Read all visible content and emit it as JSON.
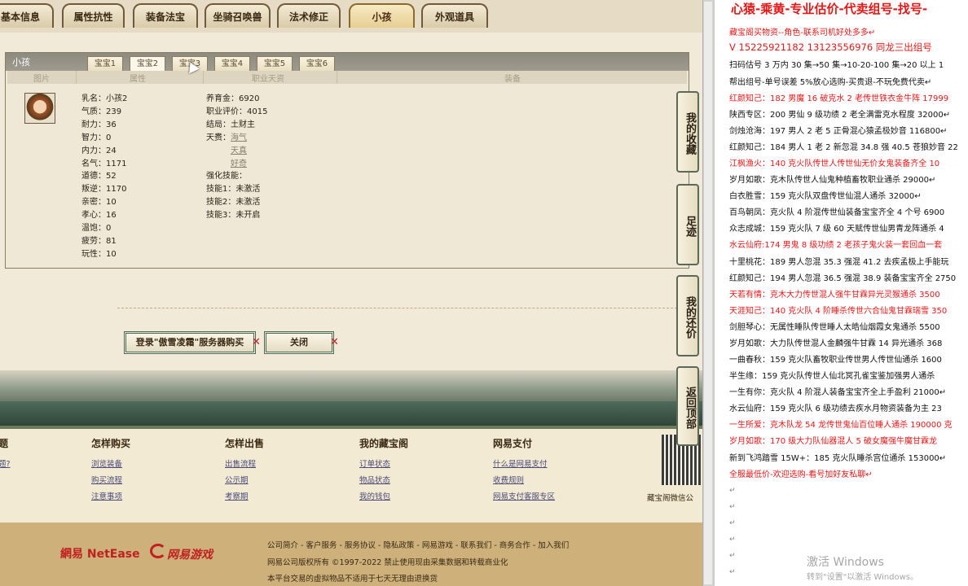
{
  "main_tabs": [
    "基本信息",
    "属性抗性",
    "装备法宝",
    "坐骑召唤兽",
    "法术修正",
    "小孩",
    "外观道具"
  ],
  "active_main_tab": "小孩",
  "panel": {
    "title": "小孩",
    "sub_tabs": [
      "宝宝1",
      "宝宝2",
      "宝宝3",
      "宝宝4",
      "宝宝5",
      "宝宝6"
    ],
    "active_sub_tab": "宝宝2",
    "columns": [
      "图片",
      "属性",
      "职业天资",
      "装备"
    ]
  },
  "child": {
    "stats": [
      "乳名：小孩2",
      "气质：239",
      "耐力：36",
      "智力：0",
      "内力：24",
      "名气：1171",
      "道德：52",
      "叛逆：1170",
      "亲密：10",
      "孝心：16",
      "温饱：0",
      "疲劳：81",
      "玩性：10"
    ],
    "career": {
      "money": "养育金：6920",
      "rating": "职业评价：4015",
      "ending": "结局：土财主",
      "talent_label": "天赉：",
      "talents": [
        "海气",
        "天真",
        "好奇"
      ],
      "enhance": "强化技能：",
      "skills": [
        "技能1：未激活",
        "技能2：未激活",
        "技能3：未开启"
      ]
    }
  },
  "buttons": {
    "register": "登录\"傲雪凌霜\"服务器购买",
    "close": "关闭",
    "x": "✕"
  },
  "side_buttons": [
    "我的收藏",
    "足迹",
    "我的还价",
    "返回顶部"
  ],
  "footer": {
    "columns": [
      {
        "title": "怎样购买",
        "links": [
          "浏览装备",
          "购买流程",
          "注意事项"
        ]
      },
      {
        "title": "怎样出售",
        "links": [
          "出售流程",
          "公示期",
          "考察期"
        ]
      },
      {
        "title": "我的藏宝阁",
        "links": [
          "订单状态",
          "物品状态",
          "我的钱包"
        ]
      },
      {
        "title": "网易支付",
        "links": [
          "什么是网易支付",
          "收费规则",
          "网易支付客服专区"
        ]
      }
    ],
    "partial_col_title": "题",
    "partial_col_link": "题?",
    "qr_caption": "藏宝阁微信公",
    "logos": [
      "網易 NetEase",
      "网易游戏"
    ],
    "bottom_lines": [
      "公司简介 - 客户服务 - 服务协议 - 隐私政策 - 网易游戏 - 联系我们 - 商务合作 - 加入我们",
      "网易公司版权所有 ©1997-2022  禁止使用现由采集数据和转载商业化",
      "本平台交易的虚拟物品不适用于七天无理由退换货"
    ]
  },
  "right_doc": {
    "title": "心猿-乘黄-专业估价-代卖组号-找号-",
    "lines": [
      {
        "text": "藏宝阁买物资--角色-联系司机好处多多↵",
        "red": true
      },
      {
        "text": "V 15225921182   13123556976 同龙三出组号",
        "red": true
      },
      {
        "text": "扫码估号 3 万内 30 集→50 集→10-20-100 集→20 以上 1",
        "red": false
      },
      {
        "text": "帮出组号-单号误差 5%放心选购-买贵退-不玩免费代卖↵",
        "red": false
      },
      {
        "text": "红颜知己：182 男魔 16 破克水 2 老传世铁衣金牛阵 17999",
        "red": true
      },
      {
        "text": "陕西专区：200 男仙 9 级功绩 2 老全满雷克水程度 32000↵",
        "red": false
      },
      {
        "text": "剑烛沧海：197 男人 2 老 5 正骨混心猿孟极妙音 116800↵",
        "red": false
      },
      {
        "text": "红颜知己：184 男人 1 老 2 新忽混 34.8 强 40.5 苍狼妙音 22",
        "red": false
      },
      {
        "text": "江枫渔火：140 克火队传世人传世仙无价女鬼装备齐全 10",
        "red": true
      },
      {
        "text": "岁月如歌：克木队传世人仙鬼种植畜牧职业通杀 29000↵",
        "red": false
      },
      {
        "text": "白衣胜雪：159 克火队双盘传世仙混人通杀 32000↵",
        "red": false
      },
      {
        "text": "百鸟朝凤：克火队 4 阶混传世仙装备宝宝齐全 4 个号 6900",
        "red": false
      },
      {
        "text": "众志成城：159 克火队 7 级 60 天赋传世仙男青龙阵通杀 4",
        "red": false
      },
      {
        "text": "水云仙府:174 男鬼 8 级功绩 2 老孩子鬼火装一套回血一套",
        "red": true
      },
      {
        "text": "十里桃花：189 男人忽混 35.3 强混 41.2 去疾孟极上手能玩",
        "red": false
      },
      {
        "text": "红颜知己：194 男人忽混 36.5 强混 38.9 装备宝宝齐全 2750",
        "red": false
      },
      {
        "text": "天若有情：克木大力传世混人强牛甘霖异光灵猴通杀 3500",
        "red": true
      },
      {
        "text": "天涯知己：140 克火队 4 阶睡杀传世六合仙鬼甘霖瑞雪 350",
        "red": true
      },
      {
        "text": "剑胆琴心：无属性睡队传世睡人太皓仙烟霞女鬼通杀 5500",
        "red": false
      },
      {
        "text": "岁月如歌：大力队传世混人金麟强牛甘霖 14 异光通杀 368",
        "red": false
      },
      {
        "text": "一曲春秋：159 克火队畜牧职业传世男人传世仙通杀 1600",
        "red": false
      },
      {
        "text": "半生缘：159 克火队传世人仙北冥孔雀宝鉴加强男人通杀",
        "red": false
      },
      {
        "text": "一生有你：克火队 4 阶混人装备宝宝齐全上手盈利 21000↵",
        "red": false
      },
      {
        "text": "水云仙府：159 克火队 6 级功绩去疾水月物资装备为主 23",
        "red": false
      },
      {
        "text": "一生所爱：克木队龙 54 龙传世鬼仙百位睡人通杀 190000 克",
        "red": true
      },
      {
        "text": "岁月如歌：170 级大力队仙器混人 5 破女魔强牛魔甘霖龙",
        "red": true
      },
      {
        "text": "新到飞鸿踏雪 15W+：185 克火队睡杀宫位通杀 153000↵",
        "red": false
      },
      {
        "text": "全服最低价-欢迎选购-看号加好友私聊↵",
        "red": true
      }
    ],
    "pilcrows": [
      "↵",
      "↵",
      "↵",
      "↵",
      "↵",
      "↵"
    ],
    "watermark": "激活 Windows",
    "watermark_sub": "转到\"设置\"以激活 Windows。"
  }
}
